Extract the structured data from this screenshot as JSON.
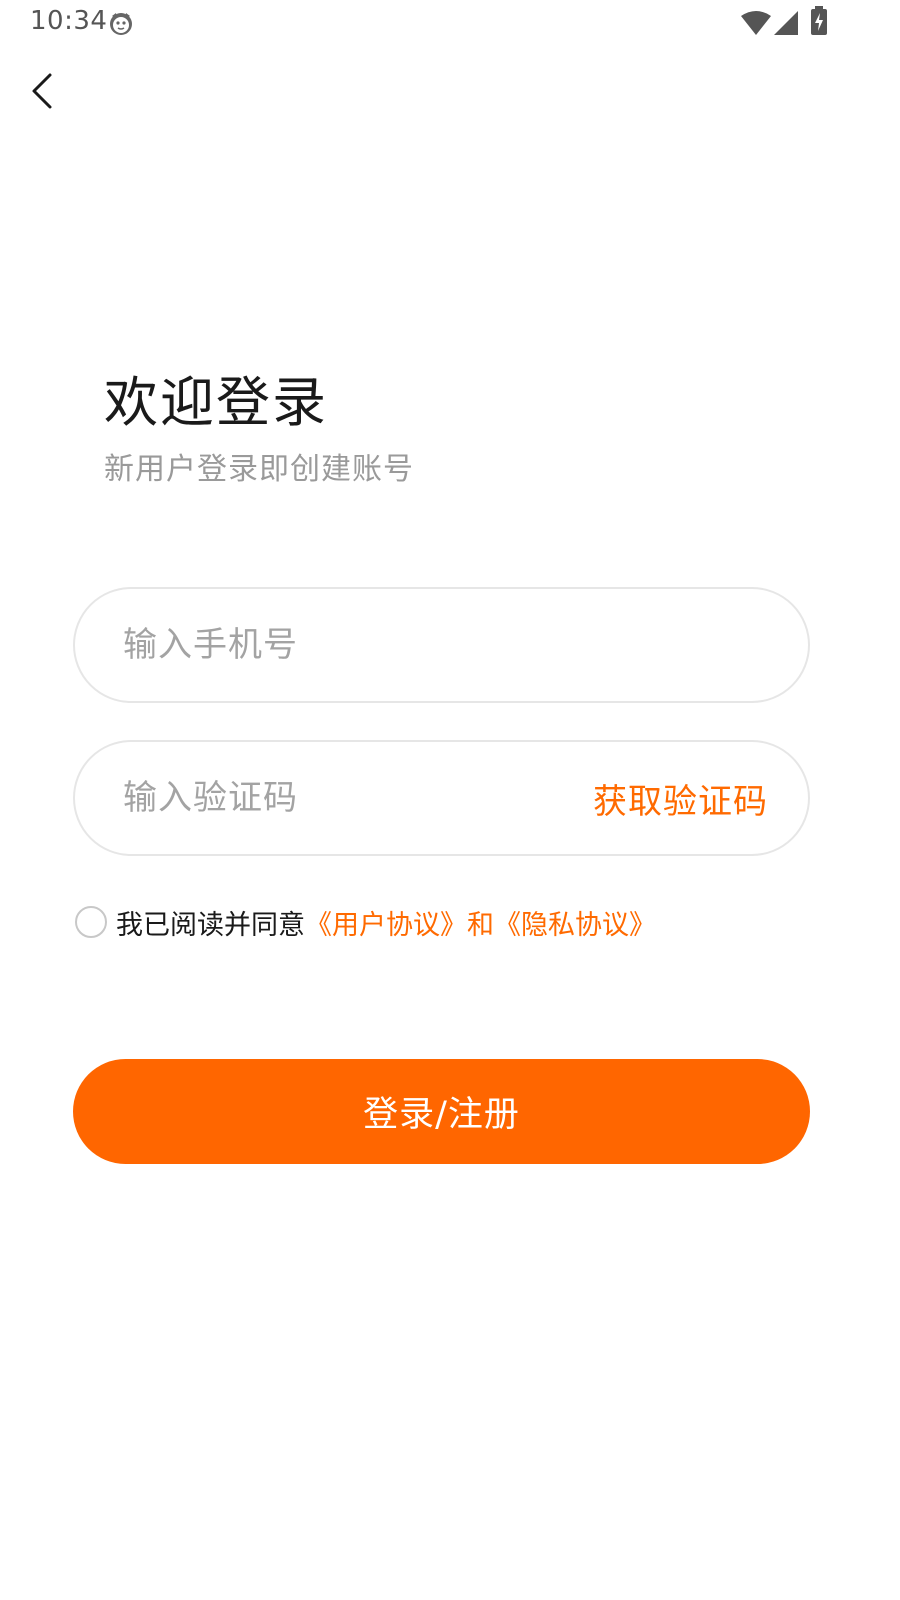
{
  "status_bar": {
    "time": "10:34",
    "icons": [
      "cat-notification-icon",
      "wifi-icon",
      "cell-signal-icon",
      "battery-charging-icon"
    ]
  },
  "nav": {
    "back_icon": "chevron-left-icon"
  },
  "header": {
    "title": "欢迎登录",
    "subtitle": "新用户登录即创建账号"
  },
  "form": {
    "phone_placeholder": "输入手机号",
    "phone_value": "",
    "code_placeholder": "输入验证码",
    "code_value": "",
    "get_code_label": "获取验证码"
  },
  "agreement": {
    "checked": false,
    "prefix": "我已阅读并同意",
    "user_agreement_link": "《用户协议》",
    "conjunction": "和",
    "privacy_link": "《隐私协议》"
  },
  "login_button_label": "登录/注册",
  "colors": {
    "accent": "#ff6600",
    "link": "#ff6a00",
    "subtitle": "#9a9a9a",
    "placeholder": "#a3a3a3",
    "field_border": "#e6e6e6"
  }
}
